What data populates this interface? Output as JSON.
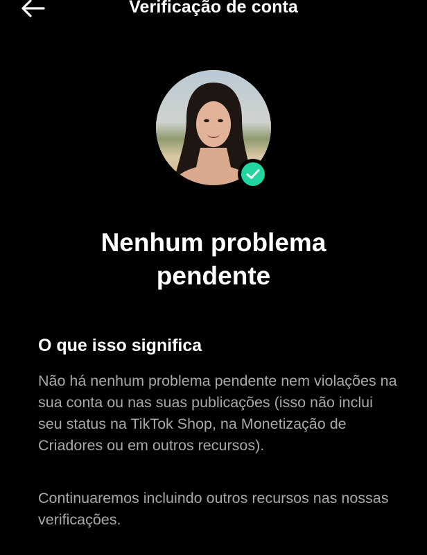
{
  "header": {
    "title": "Verificação de conta",
    "back_icon": "arrow-left-icon"
  },
  "profile": {
    "badge_icon": "check-circle-icon",
    "badge_color": "#20d5a0"
  },
  "status": {
    "headline_line1": "Nenhum problema",
    "headline_line2": "pendente"
  },
  "info": {
    "section_title": "O que isso significa",
    "paragraph1": "Não há nenhum problema pendente nem violações na sua conta ou nas suas publicações (isso não inclui seu status na TikTok Shop, na Monetização de Criadores ou em outros recursos).",
    "paragraph2": "Continuaremos incluindo outros recursos nas nossas verificações."
  },
  "colors": {
    "background": "#000000",
    "text_primary": "#ffffff",
    "text_secondary": "#a8a8a8",
    "accent": "#20d5a0"
  }
}
